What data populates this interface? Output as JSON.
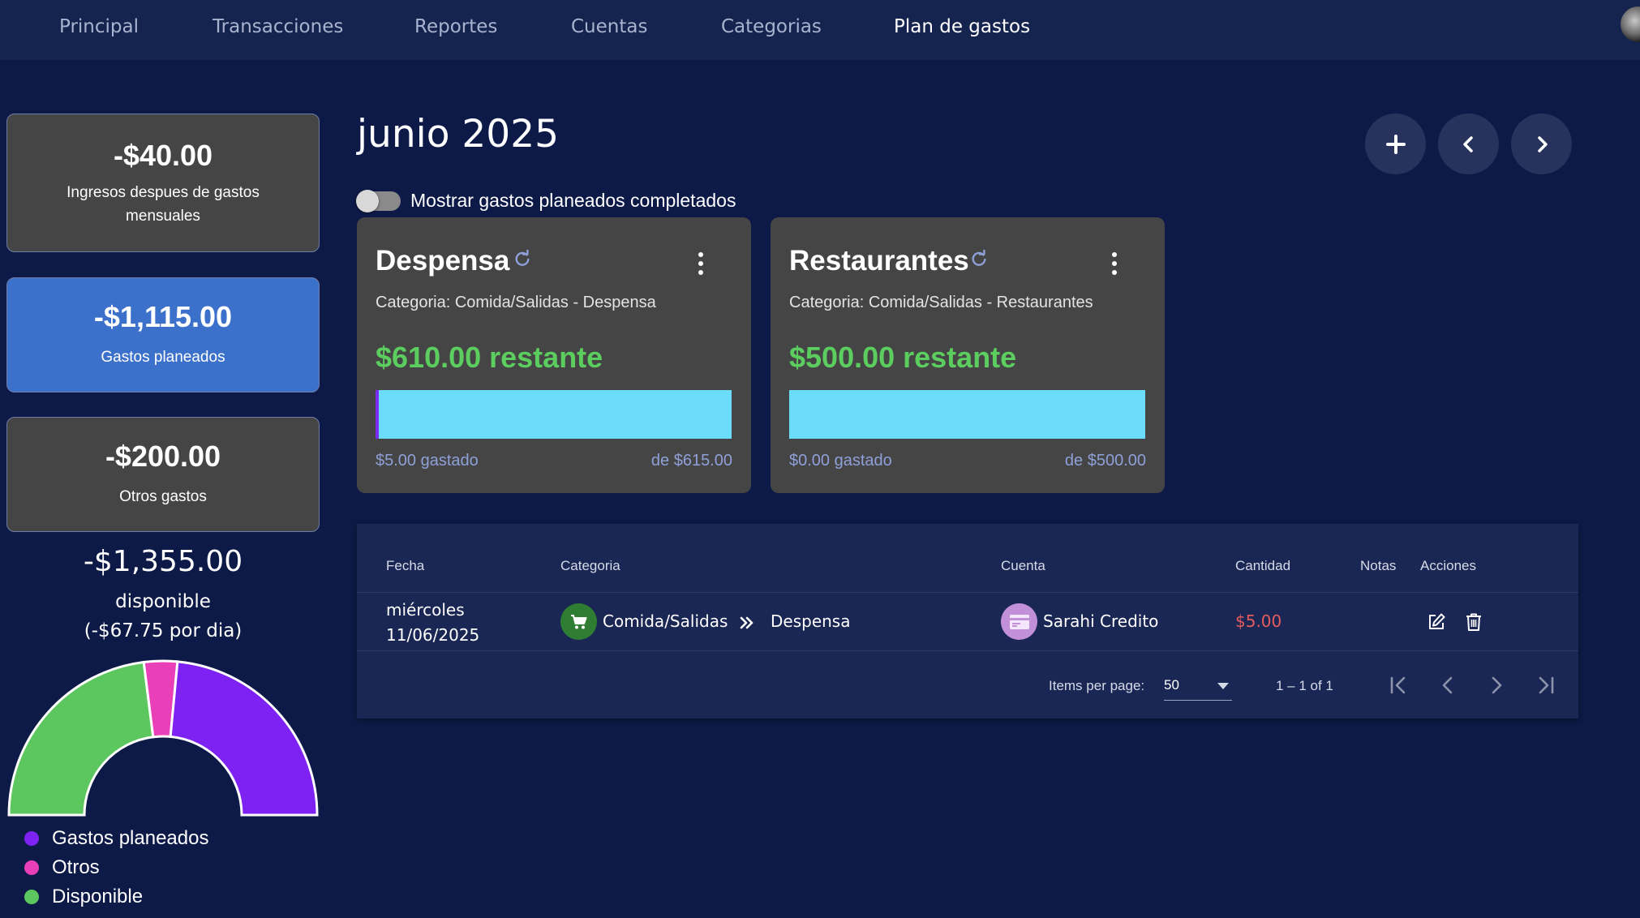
{
  "nav": {
    "items": [
      {
        "label": "Principal"
      },
      {
        "label": "Transacciones"
      },
      {
        "label": "Reportes"
      },
      {
        "label": "Cuentas"
      },
      {
        "label": "Categorias"
      },
      {
        "label": "Plan de gastos",
        "active": true
      }
    ]
  },
  "summary": {
    "income_after": {
      "value": "-$40.00",
      "label_line1": "Ingresos despues de gastos",
      "label_line2": "mensuales"
    },
    "planned": {
      "value": "-$1,115.00",
      "label": "Gastos planeados"
    },
    "other": {
      "value": "-$200.00",
      "label": "Otros gastos"
    },
    "available": {
      "value": "-$1,355.00",
      "label": "disponible",
      "per_day": "(-$67.75 por dia)"
    }
  },
  "donut": {
    "segments": [
      {
        "name": "Disponible",
        "fraction": 0.46,
        "color": "#5cc75f"
      },
      {
        "name": "Otros",
        "fraction": 0.07,
        "color": "#e940b9"
      },
      {
        "name": "Gastos planeados",
        "fraction": 0.47,
        "color": "#7d22f2"
      }
    ],
    "legend": [
      {
        "label": "Gastos planeados",
        "color": "#7d22f2"
      },
      {
        "label": "Otros",
        "color": "#e940b9"
      },
      {
        "label": "Disponible",
        "color": "#5cc75f"
      }
    ]
  },
  "header": {
    "month": "junio 2025",
    "toggle_label": "Mostrar gastos planeados completados",
    "toggle_on": false
  },
  "budgets": [
    {
      "title": "Despensa",
      "category": "Categoria: Comida/Salidas - Despensa",
      "remaining": "$610.00 restante",
      "spent": "$5.00 gastado",
      "total": "de $615.00",
      "progress": 0.0081
    },
    {
      "title": "Restaurantes",
      "category": "Categoria: Comida/Salidas - Restaurantes",
      "remaining": "$500.00 restante",
      "spent": "$0.00 gastado",
      "total": "de $500.00",
      "progress": 0
    }
  ],
  "table": {
    "headers": {
      "date": "Fecha",
      "category": "Categoria",
      "account": "Cuenta",
      "amount": "Cantidad",
      "notes": "Notas",
      "actions": "Acciones"
    },
    "rows": [
      {
        "weekday": "miércoles",
        "date": "11/06/2025",
        "category": "Comida/Salidas",
        "subcategory": "Despensa",
        "account": "Sarahi Credito",
        "amount": "$5.00",
        "notes": ""
      }
    ],
    "pager": {
      "items_per_page_label": "Items per page:",
      "items_per_page": "50",
      "range": "1 – 1 of 1"
    }
  },
  "colors": {
    "background": "#0d1a47",
    "nav": "#15234f",
    "card": "#454545",
    "blue_card": "#3b70cb",
    "positive": "#5ccd5f",
    "negative": "#e35d5d",
    "bar": "#6bdcfa",
    "bar_fill": "#7a2cf0"
  }
}
